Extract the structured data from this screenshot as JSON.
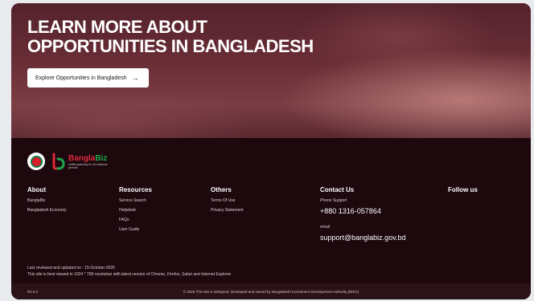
{
  "hero": {
    "title_line1": "LEARN MORE ABOUT",
    "title_line2": "OPPORTUNITIES IN BANGLADESH",
    "cta_label": "Explore Opportunities in Bangladesh",
    "cta_icon": "arrow-right-icon"
  },
  "logos": {
    "bangla": "Bangla",
    "biz": "Biz",
    "tagline": "unified gateway for all business permits"
  },
  "columns": {
    "about": {
      "title": "About",
      "links": [
        "BanglaBiz",
        "Bangladesh Economy"
      ]
    },
    "resources": {
      "title": "Resources",
      "links": [
        "Service Search",
        "Helpdesk",
        "FAQs",
        "User Guide"
      ]
    },
    "others": {
      "title": "Others",
      "links": [
        "Terms Of Use",
        "Privacy Statement"
      ]
    },
    "contact": {
      "title": "Contact Us",
      "phone_label": "Phone Support",
      "phone": "+880 1316-057864",
      "email_label": "email",
      "email": "support@banglabiz.gov.bd"
    },
    "follow": {
      "title": "Follow us"
    }
  },
  "meta": {
    "reviewed": "Last reviewed and updated on : 15-October-2025",
    "best_viewed": "This site is best viewed in 1024 * 768 resolution with latest version of Chrome, Firefox, Safari and Internet Explorer",
    "version": "R2.0.1",
    "copyright": "© 2025 This site is designed, developed and owned by Bangladesh Investment Development Authority (BIDA)"
  },
  "colors": {
    "footer_bg": "#1c080d",
    "brand_red": "#e0283b",
    "brand_green": "#1fa34a"
  }
}
